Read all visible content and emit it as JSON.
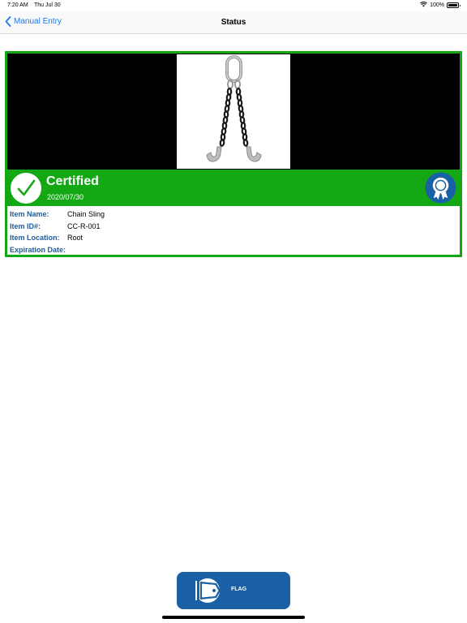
{
  "status_bar": {
    "time": "7:20 AM",
    "date": "Thu Jul 30",
    "battery": "100%",
    "battery_level": 1.0
  },
  "nav": {
    "back_label": "Manual Entry",
    "title": "Status"
  },
  "card": {
    "status_title": "Certified",
    "status_date": "2020/07/30",
    "colors": {
      "certified_green": "#14a815",
      "label_blue": "#1f5c9a"
    },
    "fields": [
      {
        "label": "Item Name:",
        "value": "Chain Sling"
      },
      {
        "label": "Item ID#:",
        "value": "CC-R-001"
      },
      {
        "label": "Item Location:",
        "value": "Root"
      },
      {
        "label": "Expiration Date:",
        "value": ""
      }
    ],
    "icons": {
      "status": "checkmark-icon",
      "badge": "award-ribbon-icon",
      "photo": "chain-sling-image"
    }
  },
  "actions": {
    "flag_label": "FLAG",
    "flag_icon": "flag-tag-icon",
    "flag_color": "#1960a6"
  }
}
